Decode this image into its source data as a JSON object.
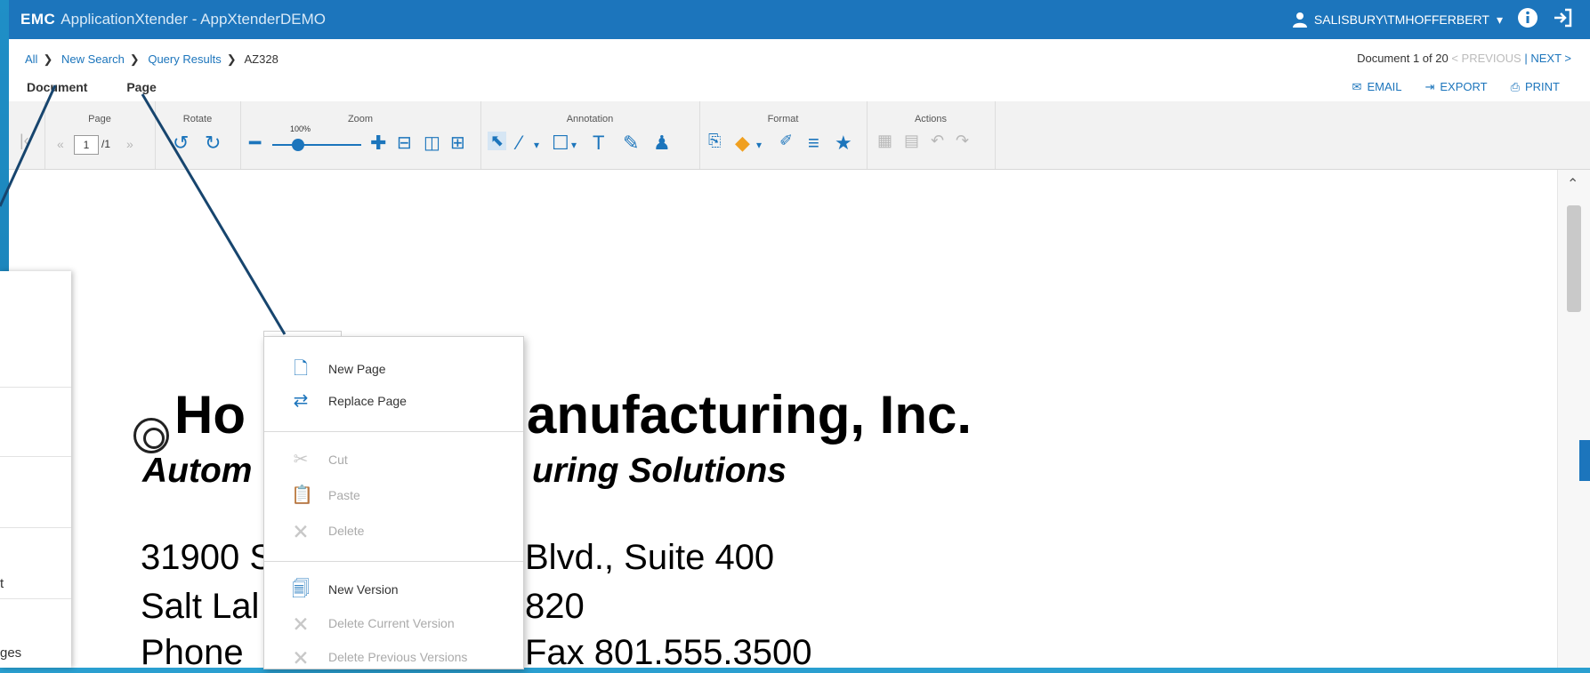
{
  "titlebar": {
    "brand": "EMC",
    "app_name": "ApplicationXtender - AppXtenderDEMO",
    "user": "SALISBURY\\TMHOFFERBERT"
  },
  "breadcrumb": [
    "All",
    "New Search",
    "Query Results",
    "AZ328"
  ],
  "menus": {
    "document": "Document",
    "page": "Page"
  },
  "doc_nav": {
    "position": "Document 1 of 20",
    "previous": "< PREVIOUS",
    "next": "NEXT >"
  },
  "doc_actions": {
    "email": "EMAIL",
    "export": "EXPORT",
    "print": "PRINT"
  },
  "ribbon": {
    "page_label": "Page",
    "rotate_label": "Rotate",
    "zoom_label": "Zoom",
    "annotation_label": "Annotation",
    "format_label": "Format",
    "actions_label": "Actions",
    "page_number": "1",
    "page_total": "/1",
    "zoom_percent": "100%"
  },
  "document": {
    "company": "Ho",
    "company_tail": "anufacturing, Inc.",
    "tagline_head": "Autom",
    "tagline_tail": "uring Solutions",
    "addr1_head": "31900 S",
    "addr1_tail": "Blvd., Suite 400",
    "addr2_head": "Salt Lal",
    "addr2_tail": "820",
    "addr3_head": "Phone",
    "addr3_tail": "Fax 801.555.3500"
  },
  "left_panel": [
    "t",
    "ges"
  ],
  "context_menu": {
    "items": [
      {
        "label": "New Page",
        "enabled": true,
        "icon": "new-page-icon"
      },
      {
        "label": "Replace Page",
        "enabled": true,
        "icon": "replace-page-icon"
      },
      {
        "label": "Cut",
        "enabled": false,
        "icon": "scissors-icon"
      },
      {
        "label": "Paste",
        "enabled": false,
        "icon": "paste-icon"
      },
      {
        "label": "Delete",
        "enabled": false,
        "icon": "delete-page-icon"
      },
      {
        "label": "New Version",
        "enabled": true,
        "icon": "new-version-icon"
      },
      {
        "label": "Delete Current Version",
        "enabled": false,
        "icon": "delete-version-icon"
      },
      {
        "label": "Delete Previous Versions",
        "enabled": false,
        "icon": "delete-previous-icon"
      }
    ]
  },
  "colors": {
    "accent": "#1c75bc",
    "background": "#1f8fc7",
    "disabled": "#aaaaaa"
  }
}
